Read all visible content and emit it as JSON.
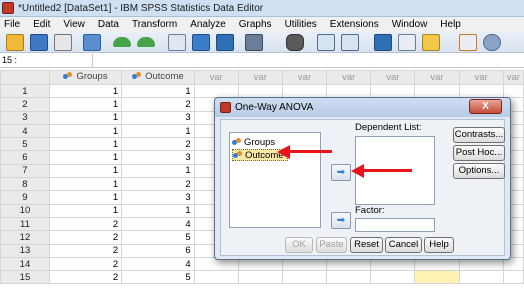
{
  "window": {
    "title": "*Untitled2 [DataSet1] - IBM SPSS Statistics Data Editor"
  },
  "menu": [
    "File",
    "Edit",
    "View",
    "Data",
    "Transform",
    "Analyze",
    "Graphs",
    "Utilities",
    "Extensions",
    "Window",
    "Help"
  ],
  "toolbar": {
    "icons": [
      "open-folder-icon",
      "save-icon",
      "print-icon",
      "recall-dialog-icon",
      "undo-icon",
      "redo-icon",
      "go-to-case-icon",
      "go-to-variable-icon",
      "variables-icon",
      "run-descriptives-icon",
      "find-icon",
      "insert-cases-icon",
      "insert-variable-icon",
      "split-file-icon",
      "weight-cases-icon",
      "select-cases-icon",
      "value-labels-icon",
      "use-sets-icon"
    ]
  },
  "cell_ref": {
    "value": "15 :"
  },
  "grid": {
    "columns": [
      "Groups",
      "Outcome",
      "var",
      "var",
      "var",
      "var",
      "var",
      "var",
      "var",
      "var"
    ],
    "rows": [
      {
        "num": "1",
        "groups": "1",
        "outcome": "1"
      },
      {
        "num": "2",
        "groups": "1",
        "outcome": "2"
      },
      {
        "num": "3",
        "groups": "1",
        "outcome": "3"
      },
      {
        "num": "4",
        "groups": "1",
        "outcome": "1"
      },
      {
        "num": "5",
        "groups": "1",
        "outcome": "2"
      },
      {
        "num": "6",
        "groups": "1",
        "outcome": "3"
      },
      {
        "num": "7",
        "groups": "1",
        "outcome": "1"
      },
      {
        "num": "8",
        "groups": "1",
        "outcome": "2"
      },
      {
        "num": "9",
        "groups": "1",
        "outcome": "3"
      },
      {
        "num": "10",
        "groups": "1",
        "outcome": "1"
      },
      {
        "num": "11",
        "groups": "2",
        "outcome": "4"
      },
      {
        "num": "12",
        "groups": "2",
        "outcome": "5"
      },
      {
        "num": "13",
        "groups": "2",
        "outcome": "6"
      },
      {
        "num": "14",
        "groups": "2",
        "outcome": "4"
      },
      {
        "num": "15",
        "groups": "2",
        "outcome": "5"
      }
    ]
  },
  "dialog": {
    "title": "One-Way ANOVA",
    "close_label": "X",
    "source_variables": [
      "Groups",
      "Outcome"
    ],
    "selected_variable": "Outcome",
    "dependent_label": "Dependent List:",
    "factor_label": "Factor:",
    "side_buttons": [
      "Contrasts...",
      "Post Hoc...",
      "Options..."
    ],
    "bottom_buttons": [
      "OK",
      "Paste",
      "Reset",
      "Cancel",
      "Help"
    ],
    "move_glyph": "➡"
  },
  "colors": {
    "annotation_arrow": "#e8131b",
    "selection": "#fbe7a8",
    "title_bar": "#cfe0f3"
  }
}
